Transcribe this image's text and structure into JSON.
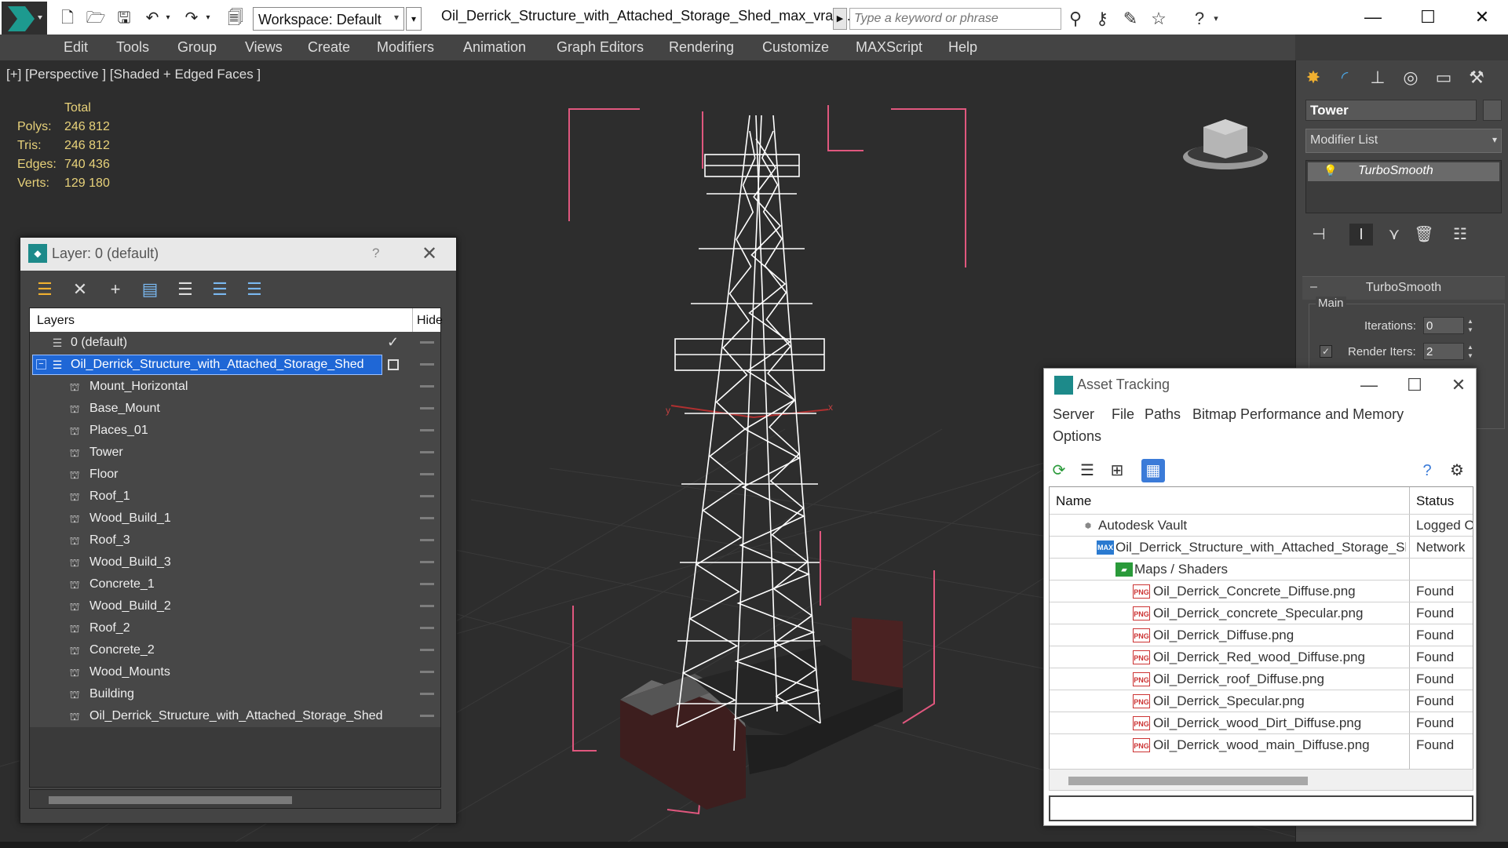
{
  "window": {
    "title": "Oil_Derrick_Structure_with_Attached_Storage_Shed_max_vray...",
    "workspace": "Workspace: Default",
    "search_placeholder": "Type a keyword or phrase"
  },
  "menubar": [
    "Edit",
    "Tools",
    "Group",
    "Views",
    "Create",
    "Modifiers",
    "Animation",
    "Graph Editors",
    "Rendering",
    "Customize",
    "MAXScript",
    "Help"
  ],
  "viewport": {
    "label": "[+] [Perspective ] [Shaded + Edged Faces ]",
    "stats": {
      "header": "Total",
      "rows": [
        {
          "label": "Polys:",
          "value": "246 812"
        },
        {
          "label": "Tris:",
          "value": "246 812"
        },
        {
          "label": "Edges:",
          "value": "740 436"
        },
        {
          "label": "Verts:",
          "value": "129 180"
        }
      ]
    },
    "axis_x": "x",
    "axis_y": "y"
  },
  "command_panel": {
    "object_name": "Tower",
    "modifier_list": "Modifier List",
    "stack_item": "TurboSmooth",
    "rollout_title": "TurboSmooth",
    "group_main": "Main",
    "iterations_label": "Iterations:",
    "iterations_value": "0",
    "render_iters_label": "Render Iters:",
    "render_iters_value": "2"
  },
  "layer_dialog": {
    "title": "Layer: 0 (default)",
    "help": "?",
    "col_layers": "Layers",
    "col_hide": "Hide",
    "rows": [
      {
        "label": "0 (default)",
        "level": 0
      },
      {
        "label": "Oil_Derrick_Structure_with_Attached_Storage_Shed",
        "level": 0
      },
      {
        "label": "Mount_Horizontal",
        "level": 1
      },
      {
        "label": "Base_Mount",
        "level": 1
      },
      {
        "label": "Places_01",
        "level": 1
      },
      {
        "label": "Tower",
        "level": 1
      },
      {
        "label": "Floor",
        "level": 1
      },
      {
        "label": "Roof_1",
        "level": 1
      },
      {
        "label": "Wood_Build_1",
        "level": 1
      },
      {
        "label": "Roof_3",
        "level": 1
      },
      {
        "label": "Wood_Build_3",
        "level": 1
      },
      {
        "label": "Concrete_1",
        "level": 1
      },
      {
        "label": "Wood_Build_2",
        "level": 1
      },
      {
        "label": "Roof_2",
        "level": 1
      },
      {
        "label": "Concrete_2",
        "level": 1
      },
      {
        "label": "Wood_Mounts",
        "level": 1
      },
      {
        "label": "Building",
        "level": 1
      },
      {
        "label": "Oil_Derrick_Structure_with_Attached_Storage_Shed",
        "level": 1
      }
    ]
  },
  "asset_dialog": {
    "title": "Asset Tracking",
    "menus": [
      "Server",
      "File",
      "Paths",
      "Bitmap Performance and Memory",
      "Options"
    ],
    "col_name": "Name",
    "col_status": "Status",
    "rows": [
      {
        "name": "Autodesk Vault",
        "status": "Logged Out",
        "icon": "vault",
        "level": 1
      },
      {
        "name": "Oil_Derrick_Structure_with_Attached_Storage_Shed_max_vray.max",
        "status": "Network",
        "icon": "max",
        "level": 2
      },
      {
        "name": "Maps / Shaders",
        "status": "",
        "icon": "maps",
        "level": 3
      },
      {
        "name": "Oil_Derrick_Concrete_Diffuse.png",
        "status": "Found",
        "icon": "png",
        "level": 4
      },
      {
        "name": "Oil_Derrick_concrete_Specular.png",
        "status": "Found",
        "icon": "png",
        "level": 4
      },
      {
        "name": "Oil_Derrick_Diffuse.png",
        "status": "Found",
        "icon": "png",
        "level": 4
      },
      {
        "name": "Oil_Derrick_Red_wood_Diffuse.png",
        "status": "Found",
        "icon": "png",
        "level": 4
      },
      {
        "name": "Oil_Derrick_roof_Diffuse.png",
        "status": "Found",
        "icon": "png",
        "level": 4
      },
      {
        "name": "Oil_Derrick_Specular.png",
        "status": "Found",
        "icon": "png",
        "level": 4
      },
      {
        "name": "Oil_Derrick_wood_Dirt_Diffuse.png",
        "status": "Found",
        "icon": "png",
        "level": 4
      },
      {
        "name": "Oil_Derrick_wood_main_Diffuse.png",
        "status": "Found",
        "icon": "png",
        "level": 4
      }
    ],
    "png_icon_text": "PNG"
  },
  "colors": {
    "selection": "#1f67d6",
    "stats_text": "#e8d27a",
    "bounding_box": "#e0577e",
    "viewport_bg": "#2d2d2d"
  }
}
